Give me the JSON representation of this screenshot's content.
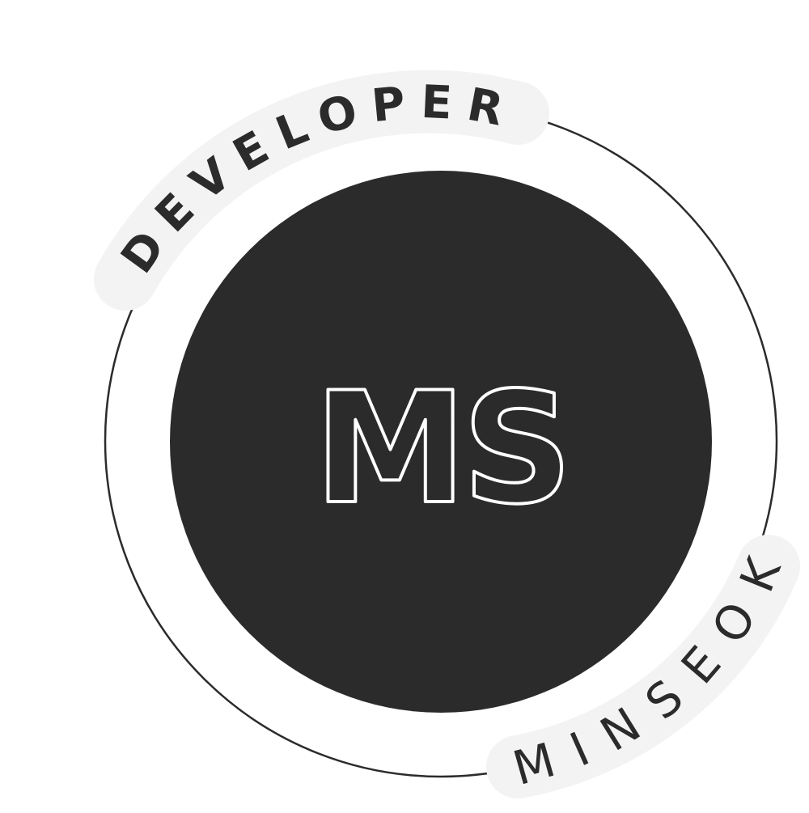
{
  "logo": {
    "top_arc_text": "DEVELOPER",
    "bottom_arc_text": "MINSEOK",
    "monogram": "MS"
  },
  "colors": {
    "background": "#ffffff",
    "disc": "#2b2b2b",
    "ring": "#2b2b2b",
    "label_band": "#f3f3f3",
    "label_text": "#2b2b2b",
    "monogram_fill": "#2b2b2b",
    "monogram_outline": "#ffffff"
  }
}
